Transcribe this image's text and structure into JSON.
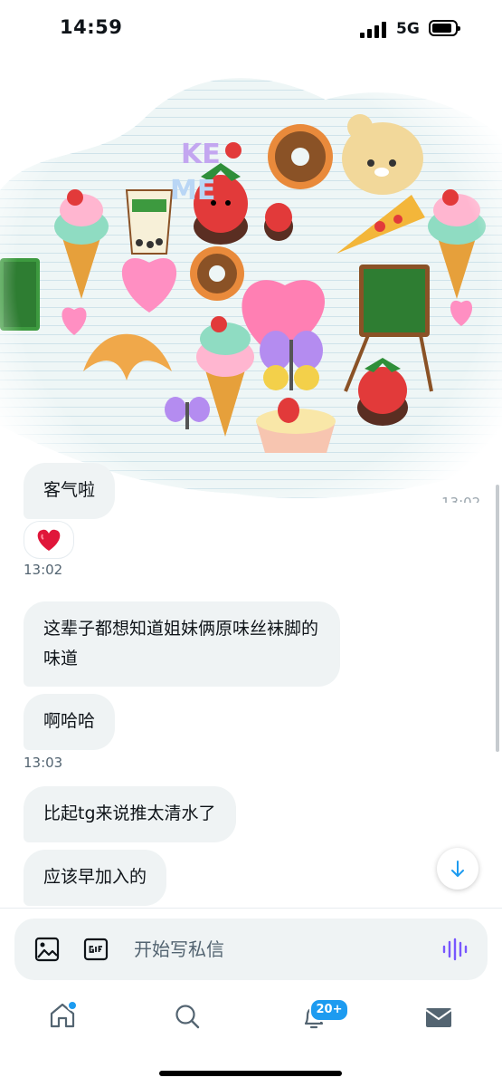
{
  "status_bar": {
    "time": "14:59",
    "network": "5G"
  },
  "sticker": {
    "time": "13:02"
  },
  "messages": [
    {
      "text": "客气啦"
    },
    {
      "reaction": "❤️"
    },
    {
      "timestamp": "13:02"
    },
    {
      "text": "这辈子都想知道姐妹俩原味丝袜脚的味道"
    },
    {
      "text": "啊哈哈"
    },
    {
      "timestamp": "13:03"
    },
    {
      "text": "比起tg来说推太清水了"
    },
    {
      "text": "应该早加入的"
    }
  ],
  "composer": {
    "placeholder": "开始写私信"
  },
  "nav": {
    "notifications_badge": "20+"
  },
  "colors": {
    "accent": "#1d9bf0",
    "bubble": "#eff3f4",
    "voice": "#7856ff"
  },
  "icons": [
    "back-arrow-icon",
    "video-icon",
    "phone-icon",
    "image-icon",
    "gif-icon",
    "voice-wave-icon",
    "arrow-down-icon",
    "home-icon",
    "search-icon",
    "bell-icon",
    "mail-icon"
  ]
}
